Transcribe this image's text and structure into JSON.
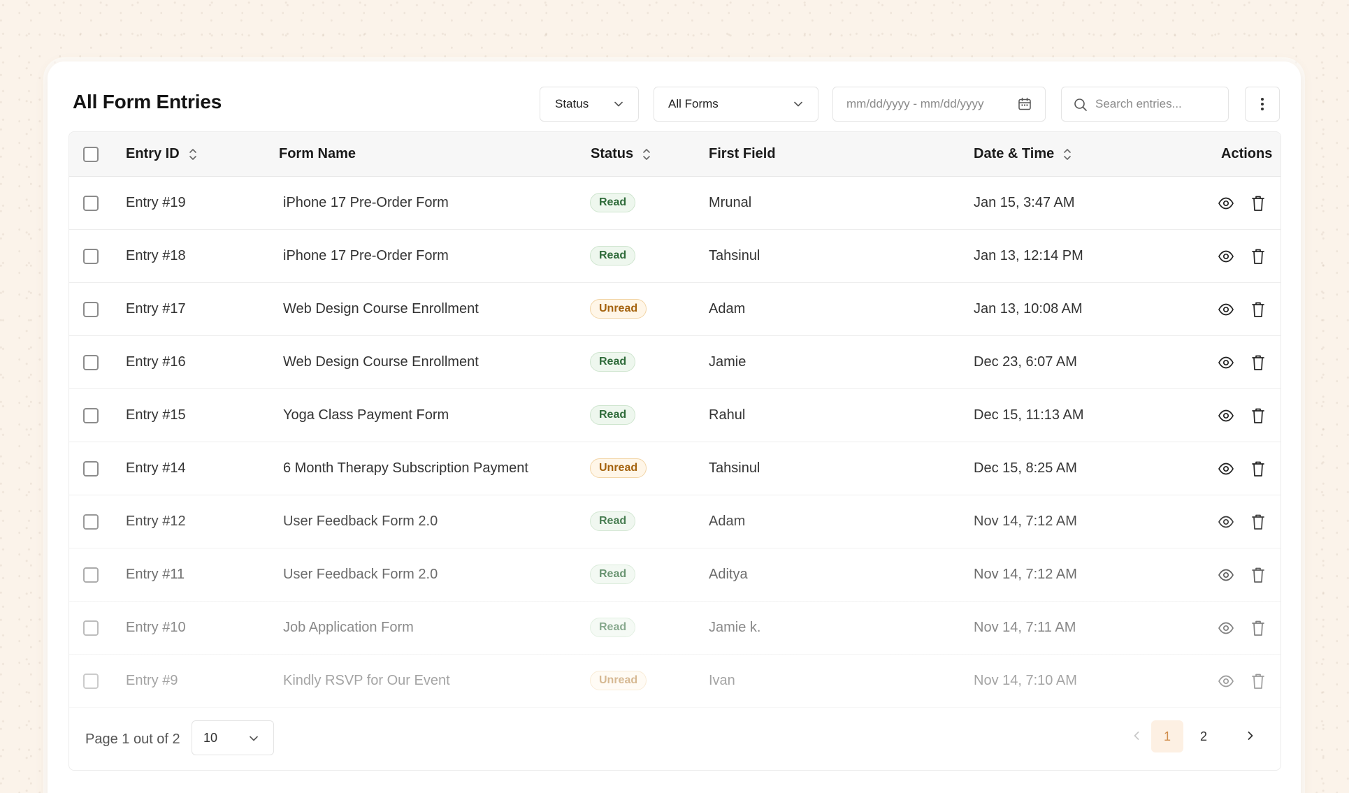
{
  "header": {
    "title": "All Form Entries",
    "status_filter": "Status",
    "forms_filter": "All Forms",
    "date_placeholder": "mm/dd/yyyy - mm/dd/yyyy",
    "search_placeholder": "Search entries..."
  },
  "columns": {
    "entry_id": "Entry ID",
    "form_name": "Form Name",
    "status": "Status",
    "first_field": "First Field",
    "date_time": "Date & Time",
    "actions": "Actions"
  },
  "rows": [
    {
      "id": "Entry #19",
      "form": "iPhone 17 Pre-Order Form",
      "status": "Read",
      "first": "Mrunal",
      "date": "Jan 15, 3:47 AM"
    },
    {
      "id": "Entry #18",
      "form": "iPhone 17 Pre-Order Form",
      "status": "Read",
      "first": "Tahsinul",
      "date": "Jan 13, 12:14 PM"
    },
    {
      "id": "Entry #17",
      "form": "Web Design Course Enrollment",
      "status": "Unread",
      "first": "Adam",
      "date": "Jan 13, 10:08 AM"
    },
    {
      "id": "Entry #16",
      "form": "Web Design Course Enrollment",
      "status": "Read",
      "first": "Jamie",
      "date": "Dec 23, 6:07 AM"
    },
    {
      "id": "Entry #15",
      "form": "Yoga Class Payment Form",
      "status": "Read",
      "first": "Rahul",
      "date": "Dec 15, 11:13 AM"
    },
    {
      "id": "Entry #14",
      "form": "6 Month Therapy Subscription Payment",
      "status": "Unread",
      "first": "Tahsinul",
      "date": "Dec 15, 8:25 AM"
    },
    {
      "id": "Entry #12",
      "form": "User Feedback Form 2.0",
      "status": "Read",
      "first": "Adam",
      "date": "Nov 14, 7:12 AM"
    },
    {
      "id": "Entry #11",
      "form": "User Feedback Form 2.0",
      "status": "Read",
      "first": "Aditya",
      "date": "Nov 14, 7:12 AM"
    },
    {
      "id": "Entry #10",
      "form": "Job Application Form",
      "status": "Read",
      "first": "Jamie k.",
      "date": "Nov 14, 7:11 AM"
    },
    {
      "id": "Entry #9",
      "form": "Kindly RSVP for Our Event",
      "status": "Unread",
      "first": "Ivan",
      "date": "Nov 14, 7:10 AM"
    }
  ],
  "footer": {
    "page_info": "Page 1 out of 2",
    "per_page": "10",
    "pages": [
      "1",
      "2"
    ]
  },
  "colors": {
    "read_badge": "#2f6b3a",
    "unread_badge": "#a4620d",
    "active_page": "#d08c4a",
    "background": "#fbf3ea"
  },
  "icons": {
    "sort": "sort-arrows-icon",
    "view": "eye-icon",
    "delete": "trash-icon",
    "calendar": "calendar-icon",
    "search": "search-icon",
    "more": "kebab-menu-icon"
  }
}
